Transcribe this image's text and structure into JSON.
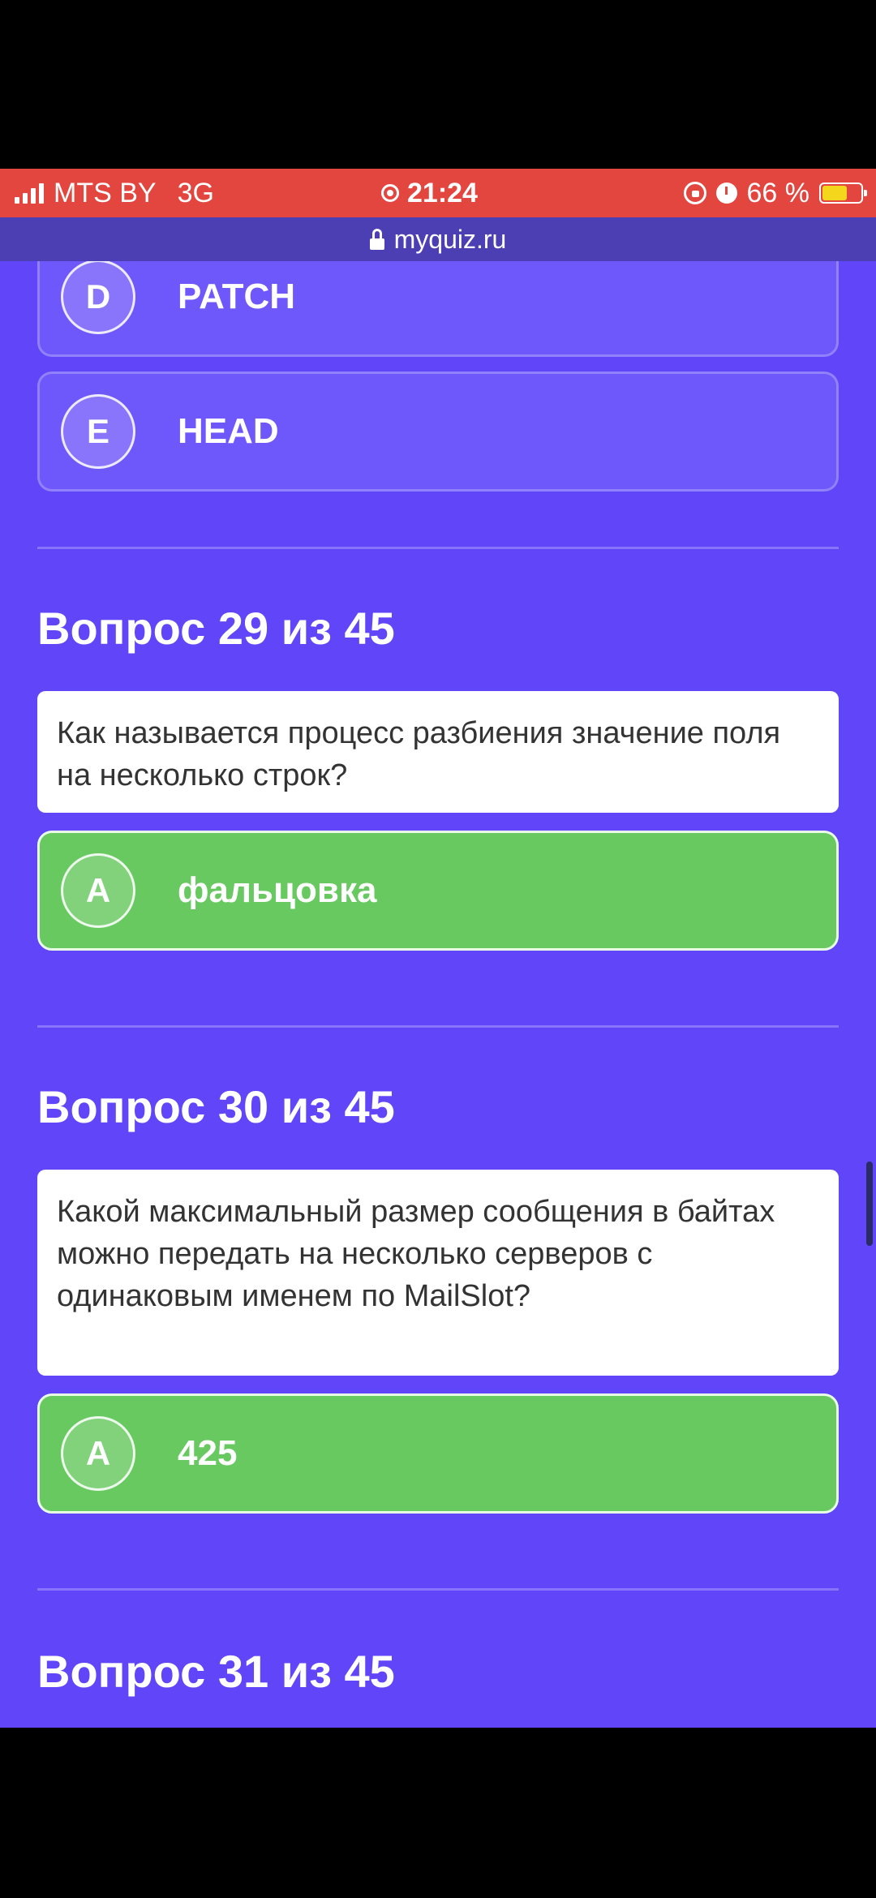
{
  "status_bar": {
    "carrier": "MTS BY",
    "network": "3G",
    "time": "21:24",
    "battery_percent": "66 %",
    "battery_level": 0.66
  },
  "url_bar": {
    "url": "myquiz.ru"
  },
  "colors": {
    "background": "#6046f8",
    "correct": "#67c960",
    "status_bar": "#e2463f"
  },
  "previous_options": [
    {
      "letter": "D",
      "text": "PATCH"
    },
    {
      "letter": "E",
      "text": "HEAD"
    }
  ],
  "questions": [
    {
      "title": "Вопрос 29 из 45",
      "text": "Как называется процесс разбиения значение поля на несколько строк?",
      "answer": {
        "letter": "A",
        "text": "фальцовка"
      }
    },
    {
      "title": "Вопрос 30 из 45",
      "text": "Какой максимальный размер сообщения в байтах можно передать на несколько серверов с одинаковым именем по MailSlot?",
      "answer": {
        "letter": "A",
        "text": "425"
      }
    },
    {
      "title": "Вопрос 31 из 45"
    }
  ]
}
